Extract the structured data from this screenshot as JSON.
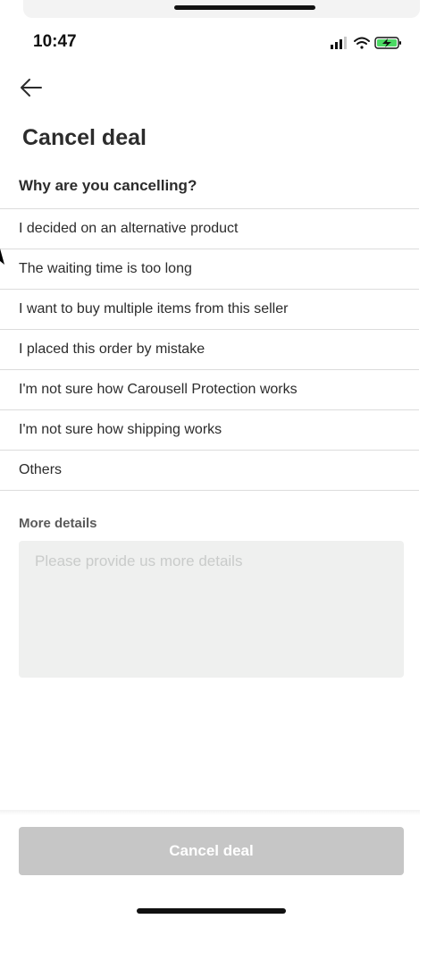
{
  "status_bar": {
    "time": "10:47"
  },
  "header": {
    "back_icon": "arrow-left-icon",
    "title": "Cancel deal"
  },
  "reasons": {
    "question": "Why are you cancelling?",
    "items": [
      "I decided on an alternative product",
      "The waiting time is too long",
      "I want to buy multiple items from this seller",
      "I placed this order by mistake",
      "I'm not sure how Carousell Protection works",
      "I'm not sure how shipping works",
      "Others"
    ]
  },
  "details": {
    "label": "More details",
    "placeholder": "Please provide us more details",
    "value": ""
  },
  "footer": {
    "button_label": "Cancel deal"
  },
  "colors": {
    "button_disabled": "#c6c6c6",
    "input_bg": "#eff0ef",
    "divider": "#dcdcdc"
  }
}
